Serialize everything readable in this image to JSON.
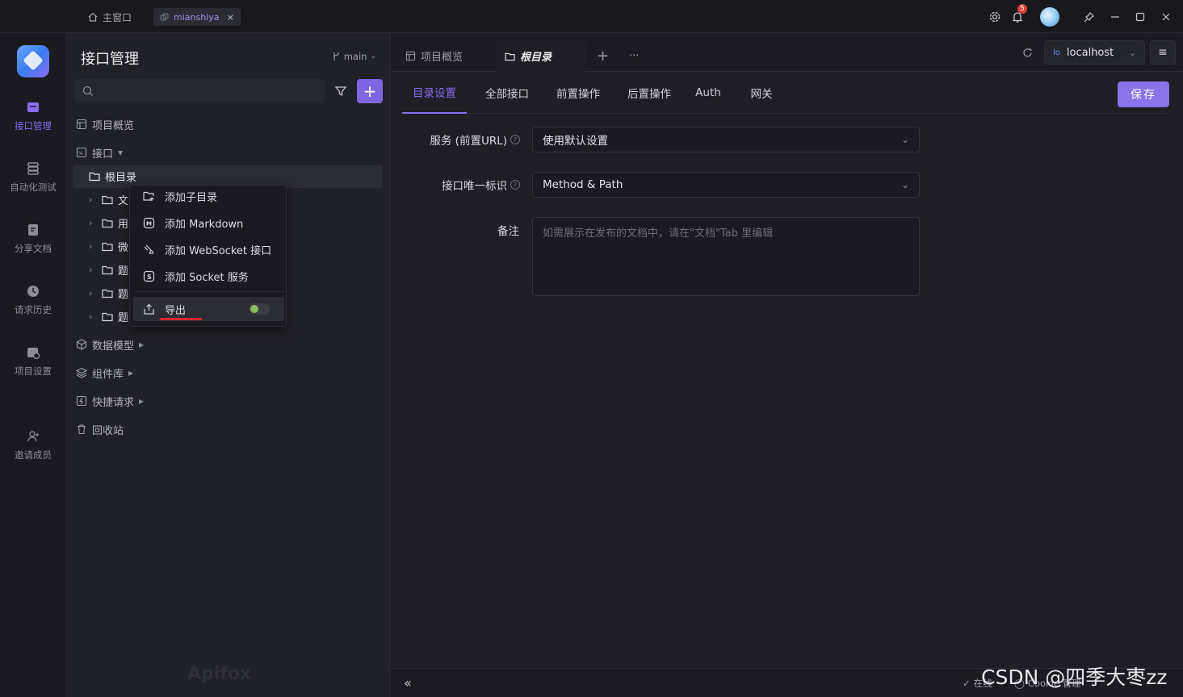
{
  "titlebar": {
    "home_label": "主窗口",
    "tab_label": "mianshiya",
    "tab_close": "×",
    "notification_count": "5"
  },
  "leftnav": {
    "items": [
      {
        "label": "接口管理",
        "icon": "api-management-icon",
        "active": true
      },
      {
        "label": "自动化测试",
        "icon": "automation-test-icon"
      },
      {
        "label": "分享文档",
        "icon": "share-docs-icon"
      },
      {
        "label": "请求历史",
        "icon": "request-history-icon"
      },
      {
        "label": "项目设置",
        "icon": "project-settings-icon"
      },
      {
        "label": "邀请成员",
        "icon": "invite-member-icon"
      }
    ]
  },
  "sidepanel": {
    "title": "接口管理",
    "branch": "main",
    "search_placeholder": "",
    "tree": {
      "overview": "项目概览",
      "api": "接口",
      "root": "根目录",
      "children": [
        "文",
        "用",
        "微",
        "题",
        "题",
        "题"
      ],
      "data_models": "数据模型",
      "components": "组件库",
      "quick_requests": "快捷请求",
      "recycle_bin": "回收站"
    },
    "watermark": "Apifox"
  },
  "context_menu": {
    "items": [
      {
        "label": "添加子目录",
        "icon": "add-folder-icon"
      },
      {
        "label": "添加 Markdown",
        "icon": "markdown-icon"
      },
      {
        "label": "添加 WebSocket 接口",
        "icon": "websocket-icon"
      },
      {
        "label": "添加 Socket 服务",
        "icon": "socket-icon"
      },
      {
        "label": "导出",
        "icon": "export-icon"
      }
    ]
  },
  "main": {
    "tabs": [
      {
        "label": "项目概览",
        "icon": "overview-icon"
      },
      {
        "label": "根目录",
        "icon": "folder-icon",
        "active": true
      }
    ],
    "add_tab": "+",
    "more_tabs": "···",
    "environment": "localhost",
    "subtabs": [
      "目录设置",
      "全部接口",
      "前置操作",
      "后置操作",
      "Auth",
      "网关"
    ],
    "active_subtab": 0,
    "save_label": "保存",
    "form": {
      "server_label": "服务 (前置URL)",
      "server_value": "使用默认设置",
      "unique_label": "接口唯一标识",
      "unique_value": "Method & Path",
      "note_label": "备注",
      "note_placeholder": "如需展示在发布的文档中，请在\"文档\"Tab 里编辑"
    },
    "status": {
      "online": "在线",
      "cookie": "Cookie 管理"
    }
  },
  "overlay_text": "CSDN @四季大枣zz",
  "colors": {
    "accent": "#8a6ff0",
    "save_button": "#8a72e8",
    "badge": "#e0403a",
    "underline_mark": "#e0252b"
  }
}
